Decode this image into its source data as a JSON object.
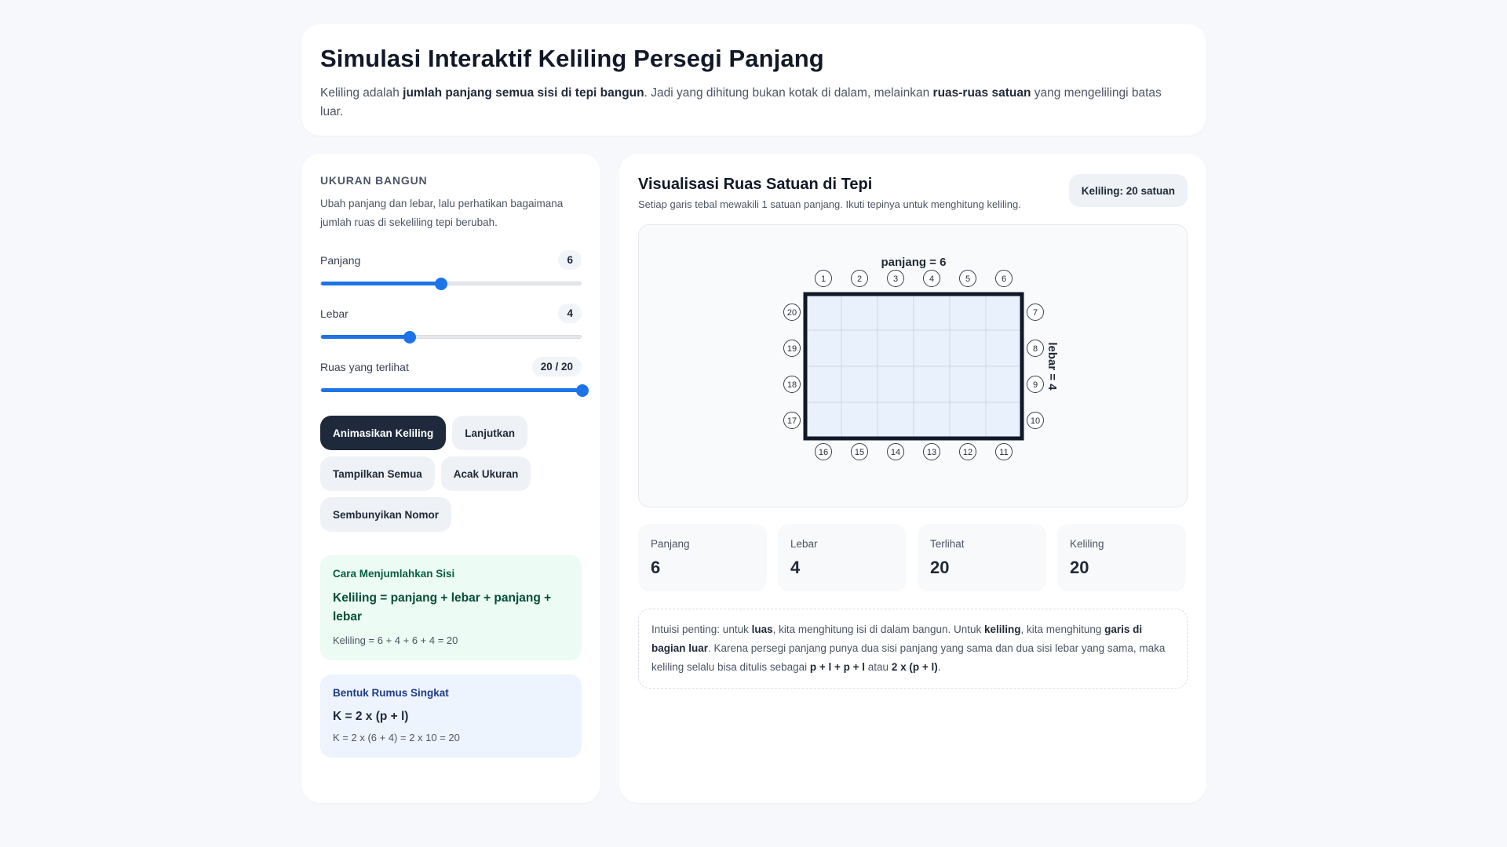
{
  "header": {
    "title": "Simulasi Interaktif Keliling Persegi Panjang",
    "desc_1": "Keliling adalah ",
    "desc_b1": "jumlah panjang semua sisi di tepi bangun",
    "desc_2": ". Jadi yang dihitung bukan kotak di dalam, melainkan ",
    "desc_b2": "ruas-ruas satuan",
    "desc_3": " yang mengelilingi batas luar."
  },
  "controls": {
    "section_title": "UKURAN BANGUN",
    "section_desc": "Ubah panjang dan lebar, lalu perhatikan bagaimana jumlah ruas di sekeliling tepi berubah.",
    "sliders": [
      {
        "label": "Panjang",
        "value_text": "6",
        "fraction": 0.46
      },
      {
        "label": "Lebar",
        "value_text": "4",
        "fraction": 0.34
      },
      {
        "label": "Ruas yang terlihat",
        "value_text": "20 / 20",
        "fraction": 1.0
      }
    ],
    "buttons": {
      "animate": "Animasikan Keliling",
      "continue": "Lanjutkan",
      "show_all": "Tampilkan Semua",
      "random": "Acak Ukuran",
      "hide_numbers": "Sembunyikan Nomor"
    },
    "sum_box": {
      "title": "Cara Menjumlahkan Sisi",
      "formula": "Keliling = panjang + lebar + panjang + lebar",
      "calc": "Keliling = 6 + 4 + 6 + 4 = 20"
    },
    "short_box": {
      "title": "Bentuk Rumus Singkat",
      "formula": "K = 2 x (p + l)",
      "calc": "K = 2 x (6 + 4) = 2 x 10 = 20"
    }
  },
  "viz": {
    "title": "Visualisasi Ruas Satuan di Tepi",
    "subtitle": "Setiap garis tebal mewakili 1 satuan panjang. Ikuti tepinya untuk menghitung keliling.",
    "badge": "Keliling: 20 satuan",
    "label_top": "panjang = 6",
    "label_right": "lebar = 4",
    "panjang": 6,
    "lebar": 4,
    "colors": {
      "fill": "#e9f1fc",
      "grid": "#cdd7e3",
      "border": "#111827"
    }
  },
  "stats": [
    {
      "label": "Panjang",
      "value": "6"
    },
    {
      "label": "Lebar",
      "value": "4"
    },
    {
      "label": "Terlihat",
      "value": "20"
    },
    {
      "label": "Keliling",
      "value": "20"
    }
  ],
  "note": {
    "p1": "Intuisi penting: untuk ",
    "b1": "luas",
    "p2": ", kita menghitung isi di dalam bangun. Untuk ",
    "b2": "keliling",
    "p3": ", kita menghitung ",
    "b3": "garis di bagian luar",
    "p4": ". Karena persegi panjang punya dua sisi panjang yang sama dan dua sisi lebar yang sama, maka keliling selalu bisa ditulis sebagai ",
    "b4": "p + l + p + l",
    "p5": " atau ",
    "b5": "2 x (p + l)",
    "p6": "."
  }
}
